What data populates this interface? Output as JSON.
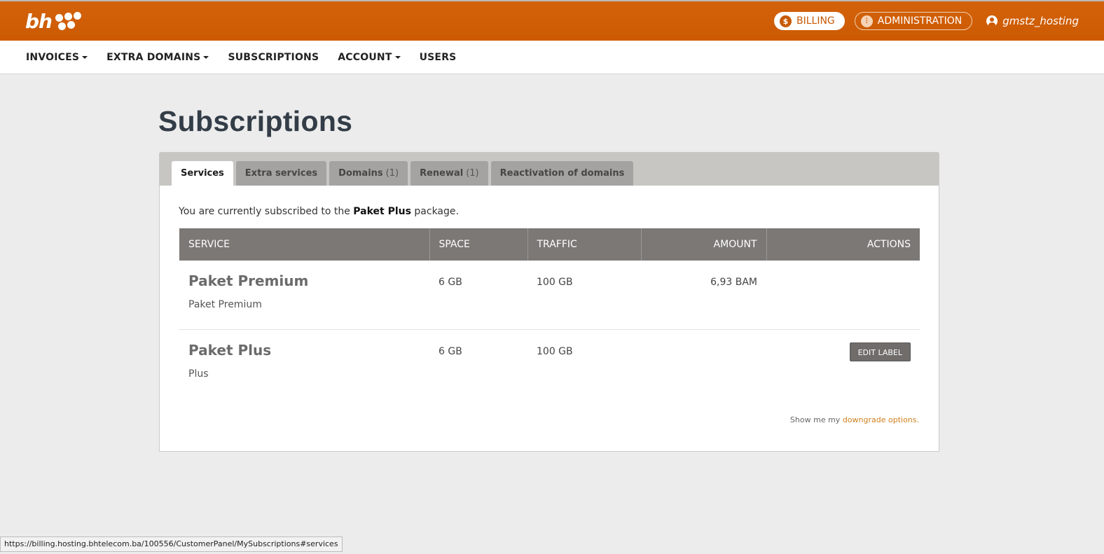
{
  "header": {
    "logo_text": "bh",
    "billing_label": "BILLING",
    "billing_icon": "dollar-icon",
    "admin_label": "ADMINISTRATION",
    "admin_icon": "sliders-icon",
    "username": "gmstz_hosting",
    "colors": {
      "brand": "#cc5a02",
      "link": "#d0811d"
    }
  },
  "nav": {
    "items": [
      {
        "label": "INVOICES",
        "dropdown": true
      },
      {
        "label": "EXTRA DOMAINS",
        "dropdown": true
      },
      {
        "label": "SUBSCRIPTIONS",
        "dropdown": false
      },
      {
        "label": "ACCOUNT",
        "dropdown": true
      },
      {
        "label": "USERS",
        "dropdown": false
      }
    ]
  },
  "page": {
    "title": "Subscriptions",
    "tabs": [
      {
        "label": "Services",
        "count": ""
      },
      {
        "label": "Extra services",
        "count": ""
      },
      {
        "label": "Domains",
        "count": "(1)"
      },
      {
        "label": "Renewal",
        "count": "(1)"
      },
      {
        "label": "Reactivation of domains",
        "count": ""
      }
    ],
    "intro_prefix": "You are currently subscribed to the",
    "intro_package": "Paket Plus",
    "intro_suffix": "package."
  },
  "table": {
    "headers": [
      "SERVICE",
      "SPACE",
      "TRAFFIC",
      "AMOUNT",
      "ACTIONS"
    ],
    "rows": [
      {
        "name": "Paket Premium",
        "label": "Paket Premium",
        "space": "6 GB",
        "traffic": "100 GB",
        "amount": "6,93 BAM",
        "action": ""
      },
      {
        "name": "Paket Plus",
        "label": "Plus",
        "space": "6 GB",
        "traffic": "100 GB",
        "amount": "",
        "action": "EDIT LABEL"
      }
    ]
  },
  "footer": {
    "downgrade_prefix": "Show me my",
    "downgrade_link": "downgrade options."
  },
  "statusbar": {
    "url": "https://billing.hosting.bhtelecom.ba/100556/CustomerPanel/MySubscriptions#services"
  }
}
